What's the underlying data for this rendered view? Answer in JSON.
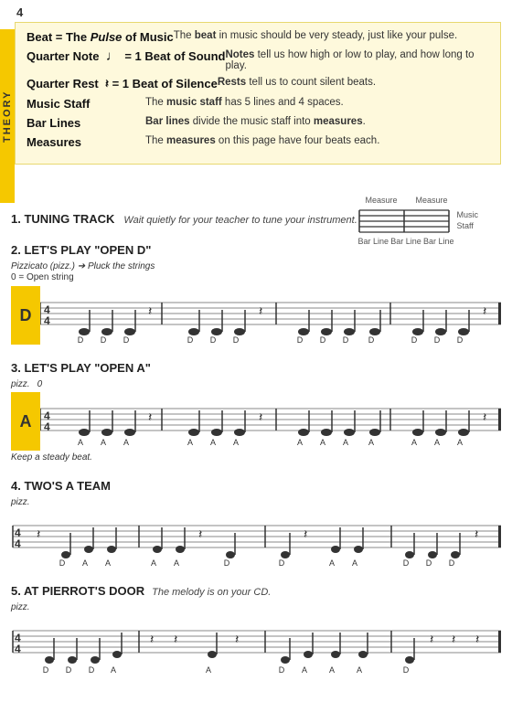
{
  "page": {
    "number": "4"
  },
  "theory_sidebar": {
    "label": "THEORY"
  },
  "theory": {
    "rows": [
      {
        "term": "Beat = The Pulse of Music",
        "term_plain": "Beat = The ",
        "term_italic": "Pulse",
        "term_end": " of Music",
        "definition": "The beat in music should be very steady, just like your pulse."
      },
      {
        "term": "Quarter Note",
        "note_symbol": "♩",
        "note_eq": " = 1 Beat of Sound",
        "definition": "Notes tell us how high or low to play, and how long to play."
      },
      {
        "term": "Quarter Rest",
        "rest_symbol": "𝄽",
        "rest_eq": " = 1 Beat of Silence",
        "definition": "Rests tell us to count silent beats."
      },
      {
        "term": "Music Staff",
        "definition": "The music staff has 5 lines and 4 spaces."
      },
      {
        "term": "Bar Lines",
        "definition": "Bar lines divide the music staff into measures."
      },
      {
        "term": "Measures",
        "definition": "The measures on this page have four beats each."
      }
    ],
    "staff_diagram": {
      "top_labels": [
        "Measure",
        "Measure"
      ],
      "bottom_labels": [
        "Bar Line",
        "Bar Line",
        "Bar Line"
      ],
      "side_label": "Music\nStaff"
    }
  },
  "sections": [
    {
      "id": "tuning",
      "number": "1.",
      "title": "TUNING TRACK",
      "subtitle": "Wait quietly for your teacher to tune your instrument.",
      "has_staff": false
    },
    {
      "id": "open-d",
      "number": "2.",
      "title": "LET'S PLAY \"OPEN D\"",
      "pizz": "Pizzicato (pizz.) ➔ Pluck the strings",
      "open": "0 = Open string",
      "note_letter": "D",
      "has_staff": true
    },
    {
      "id": "open-a",
      "number": "3.",
      "title": "LET'S PLAY \"OPEN A\"",
      "pizz": "pizz.",
      "open": "0",
      "note_letter": "A",
      "keep_steady": "Keep a steady beat.",
      "has_staff": true
    },
    {
      "id": "twos-a-team",
      "number": "4.",
      "title": "TWO'S A TEAM",
      "pizz": "pizz.",
      "has_staff": true,
      "no_box": true
    },
    {
      "id": "pierrot",
      "number": "5.",
      "title": "AT PIERROT'S DOOR",
      "subtitle": "The melody is on your CD.",
      "pizz": "pizz.",
      "has_staff": true,
      "no_box": true
    }
  ]
}
